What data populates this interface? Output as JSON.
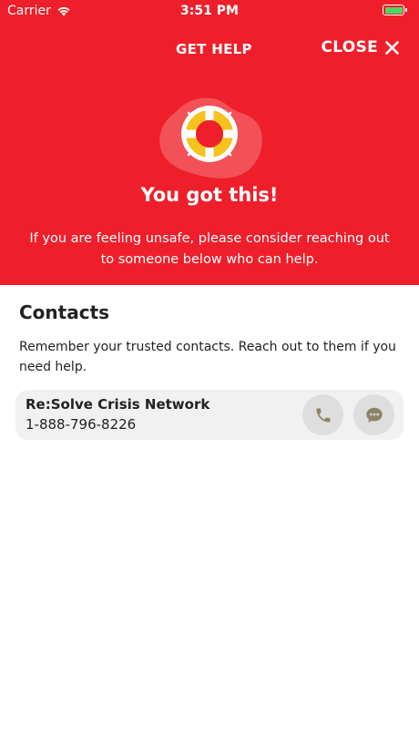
{
  "status_bar": {
    "carrier": "Carrier",
    "time": "3:51 PM"
  },
  "header": {
    "help_label": "GET HELP",
    "close_label": "CLOSE",
    "title": "You got this!",
    "subtitle": "If you are feeling unsafe, please consider reaching out to someone below who can help."
  },
  "contacts": {
    "title": "Contacts",
    "description": "Remember your trusted contacts. Reach out to them if you need help.",
    "items": [
      {
        "name": "Re:Solve Crisis Network",
        "phone": "1-888-796-8226"
      }
    ]
  },
  "colors": {
    "header_bg": "#ee1f2b",
    "ring_yellow": "#f7c21e",
    "button_bg": "#dedede",
    "icon_olive": "#8b8466"
  },
  "icons": {
    "hero": "lifebuoy-icon",
    "close": "close-icon",
    "call": "phone-icon",
    "message": "chat-bubble-icon"
  }
}
